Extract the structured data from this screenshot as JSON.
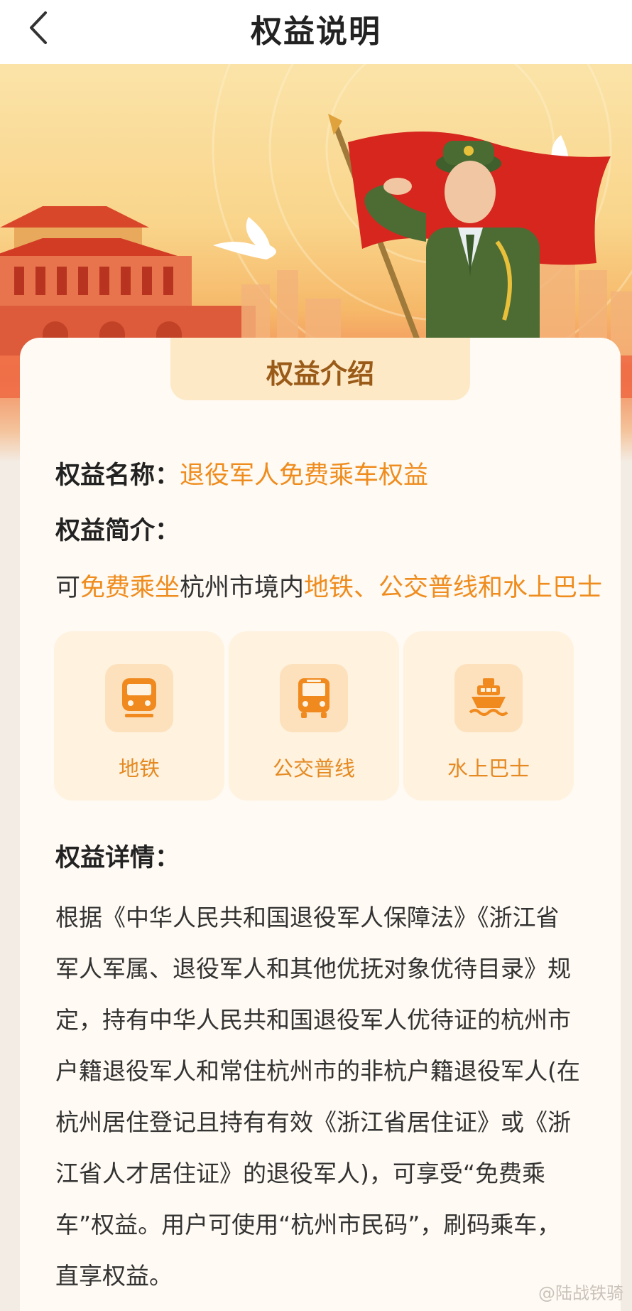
{
  "nav": {
    "title": "权益说明"
  },
  "intro_header": "权益介绍",
  "name": {
    "label": "权益名称：",
    "value": "退役军人免费乘车权益"
  },
  "summary": {
    "label": "权益简介：",
    "parts": [
      "可",
      "免费乘坐",
      "杭州市境内",
      "地铁、公交普线和水上巴士"
    ]
  },
  "tiles": [
    {
      "label": "地铁",
      "icon": "subway-icon"
    },
    {
      "label": "公交普线",
      "icon": "bus-icon"
    },
    {
      "label": "水上巴士",
      "icon": "ferry-icon"
    }
  ],
  "details": {
    "label": "权益详情：",
    "lines": [
      "根据《中华人民共和国退役军人保障法》《浙江省",
      "军人军属、退役军人和其他优抚对象优待目录》规",
      "定，持有中华人民共和国退役军人优待证的杭州市",
      "户籍退役军人和常住杭州市的非杭户籍退役军人(在",
      "杭州居住登记且持有有效《浙江省居住证》或《浙",
      "江省人才居住证》的退役军人)，可享受“免费乘",
      "车”权益。用户可使用“杭州市民码”，刷码乘车，",
      "直享权益。"
    ]
  },
  "watermark": "@陆战铁骑",
  "colors": {
    "accent": "#ef8c1e",
    "tile_bg": "#fff2df",
    "header_bg": "#fde9c6"
  }
}
